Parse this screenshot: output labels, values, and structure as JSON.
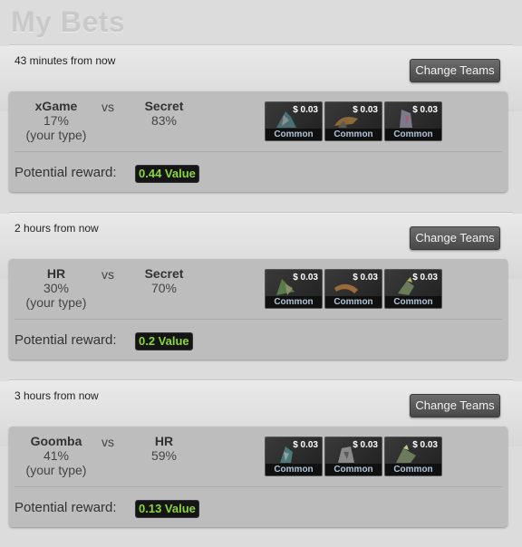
{
  "page": {
    "title": "My Bets"
  },
  "bets": [
    {
      "time": "43 minutes from now",
      "change_label": "Change Teams",
      "team_a": {
        "name": "xGame",
        "percent": "17%",
        "note": "(your type)"
      },
      "vs": "vs",
      "team_b": {
        "name": "Secret",
        "percent": "83%"
      },
      "items": [
        {
          "price": "$ 0.03",
          "rarity": "Common",
          "art": "hero-item-icon"
        },
        {
          "price": "$ 0.03",
          "rarity": "Common",
          "art": "hero-item-icon"
        },
        {
          "price": "$ 0.03",
          "rarity": "Common",
          "art": "hero-item-icon"
        }
      ],
      "reward_label": "Potential reward:",
      "reward_value": "0.44 Value"
    },
    {
      "time": "2 hours from now",
      "change_label": "Change Teams",
      "team_a": {
        "name": "HR",
        "percent": "30%",
        "note": "(your type)"
      },
      "vs": "vs",
      "team_b": {
        "name": "Secret",
        "percent": "70%"
      },
      "items": [
        {
          "price": "$ 0.03",
          "rarity": "Common",
          "art": "hero-item-icon"
        },
        {
          "price": "$ 0.03",
          "rarity": "Common",
          "art": "hero-item-icon"
        },
        {
          "price": "$ 0.03",
          "rarity": "Common",
          "art": "hero-item-icon"
        }
      ],
      "reward_label": "Potential reward:",
      "reward_value": "0.2 Value"
    },
    {
      "time": "3 hours from now",
      "change_label": "Change Teams",
      "team_a": {
        "name": "Goomba",
        "percent": "41%",
        "note": "(your type)"
      },
      "vs": "vs",
      "team_b": {
        "name": "HR",
        "percent": "59%"
      },
      "items": [
        {
          "price": "$ 0.03",
          "rarity": "Common",
          "art": "hero-item-icon"
        },
        {
          "price": "$ 0.03",
          "rarity": "Common",
          "art": "hero-item-icon"
        },
        {
          "price": "$ 0.03",
          "rarity": "Common",
          "art": "hero-item-icon"
        }
      ],
      "reward_label": "Potential reward:",
      "reward_value": "0.13 Value"
    }
  ],
  "colors": {
    "reward_text": "#8bd63a",
    "rarity_text": "#b0c3d9",
    "card_bg": "#bdbdbd"
  }
}
